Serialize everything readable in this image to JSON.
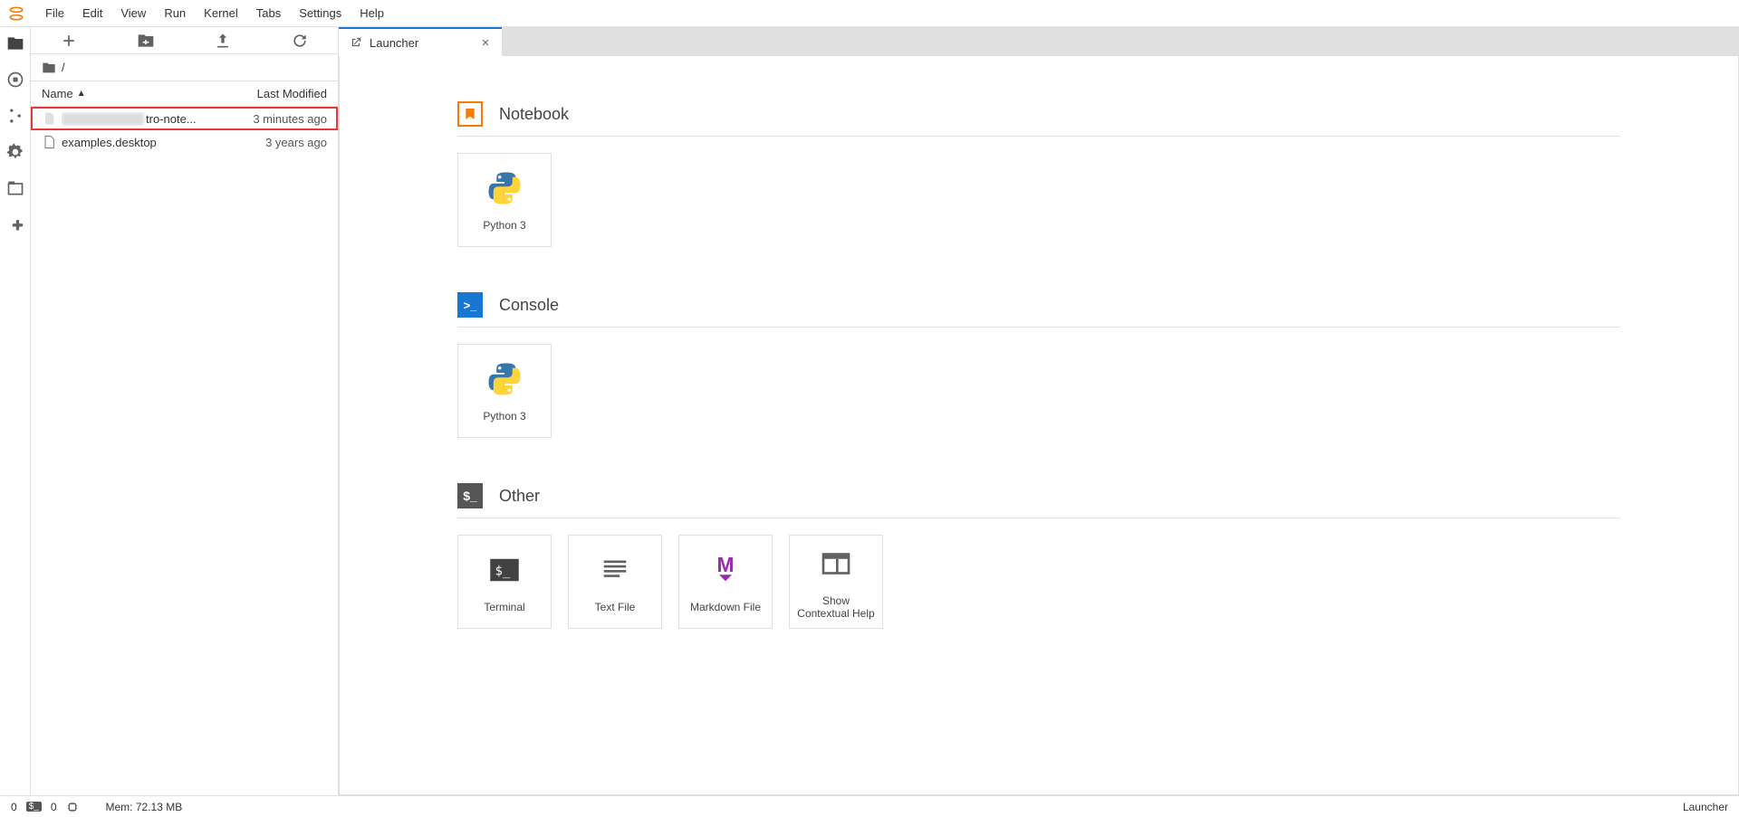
{
  "menu": [
    "File",
    "Edit",
    "View",
    "Run",
    "Kernel",
    "Tabs",
    "Settings",
    "Help"
  ],
  "breadcrumb": {
    "path": "/"
  },
  "fileBrowser": {
    "headers": {
      "name": "Name",
      "modified": "Last Modified"
    },
    "items": [
      {
        "nameSuffix": "tro-note...",
        "modified": "3 minutes ago",
        "highlighted": true,
        "blurred": true,
        "type": "notebook"
      },
      {
        "name": "examples.desktop",
        "modified": "3 years ago",
        "highlighted": false,
        "type": "file"
      }
    ]
  },
  "tab": {
    "title": "Launcher"
  },
  "launcher": {
    "sections": [
      {
        "key": "notebook",
        "title": "Notebook",
        "cards": [
          {
            "label": "Python 3",
            "icon": "python"
          }
        ]
      },
      {
        "key": "console",
        "title": "Console",
        "cards": [
          {
            "label": "Python 3",
            "icon": "python"
          }
        ]
      },
      {
        "key": "other",
        "title": "Other",
        "cards": [
          {
            "label": "Terminal",
            "icon": "terminal"
          },
          {
            "label": "Text File",
            "icon": "textfile"
          },
          {
            "label": "Markdown File",
            "icon": "markdown"
          },
          {
            "label": "Show Contextual Help",
            "icon": "contextual"
          }
        ]
      }
    ]
  },
  "statusbar": {
    "terminals": "0",
    "kernels": "0",
    "memory": "Mem: 72.13 MB",
    "right": "Launcher"
  }
}
